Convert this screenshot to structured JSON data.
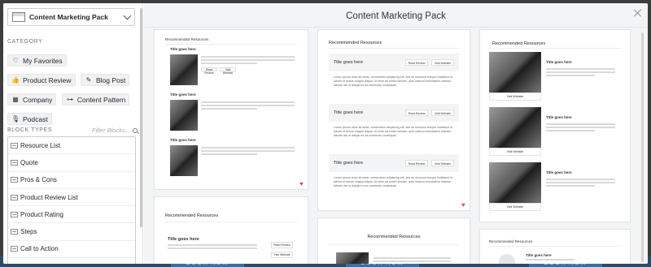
{
  "sidebar": {
    "pack_select": {
      "label": "Content Marketing Pack"
    },
    "category_heading": "CATEGORY",
    "categories": [
      {
        "label": "My Favorites",
        "icon": "heart-outline-icon"
      },
      {
        "label": "Product Review",
        "icon": "thumbs-up-icon"
      },
      {
        "label": "Blog Post",
        "icon": "pencil-icon"
      },
      {
        "label": "Company",
        "icon": "building-icon"
      },
      {
        "label": "Content Pattern",
        "icon": "network-icon"
      },
      {
        "label": "Podcast",
        "icon": "microphone-icon"
      }
    ],
    "block_types_heading": "BLOCK TYPES",
    "filter_placeholder": "Filter Blocks...",
    "block_types": [
      "Resource List",
      "Quote",
      "Pros & Cons",
      "Product Review List",
      "Product Rating",
      "Steps",
      "Call to Action"
    ]
  },
  "main": {
    "title": "Content Marketing Pack"
  },
  "cards": {
    "c1": {
      "heading": "Recommended Resources",
      "items": [
        "Title goes here",
        "Title goes here",
        "Title goes here"
      ],
      "btn_a": "Read Review",
      "btn_b": "Visit Website"
    },
    "c2": {
      "heading": "Recommended Resources",
      "items": [
        "Title goes here",
        "Title goes here",
        "Title goes here"
      ],
      "btn_a": "Read Review",
      "btn_b": "Visit Website",
      "body": "Lorem ipsum dolor sit amet, consectetur adipiscing elit, sed do eiusmod tempor incididunt ut labore et dolore magna aliqua. Ut enim ad minim veniam, quis nostrud exercitation ullamco laboris nisi ut aliquip ex ea commodo consequat."
    },
    "c3": {
      "heading": "Recommended Resources",
      "items": [
        "Title goes here",
        "Title goes here",
        "Title goes here"
      ],
      "caption": "Visit Website"
    },
    "c4": {
      "heading": "Recommended Resources",
      "title": "Title goes here",
      "btn_a": "Read Review",
      "btn_b": "Visit Website"
    },
    "c5": {
      "heading": "Recommended Resources"
    },
    "c6": {
      "heading": "Recommended Resources",
      "title": "Title goes here"
    }
  },
  "backdrop": {
    "button_label": "BOOK NOW"
  },
  "colors": {
    "favorite_heart": "#e24c4c",
    "backdrop_band": "#2f4a66"
  }
}
